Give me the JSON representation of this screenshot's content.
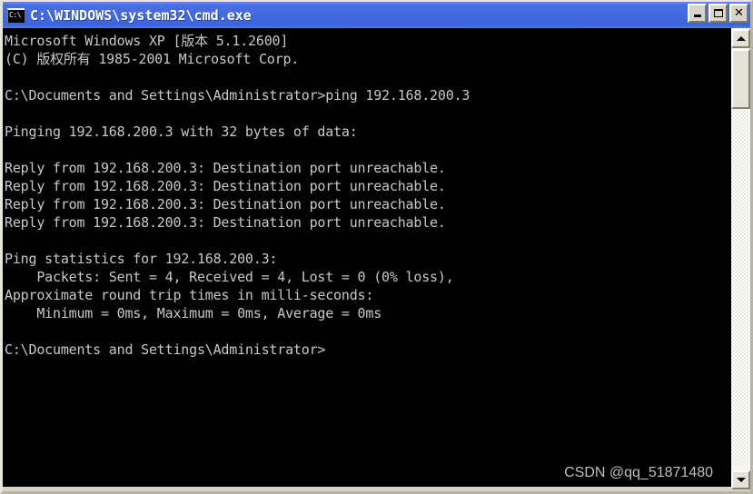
{
  "window": {
    "title": "C:\\WINDOWS\\system32\\cmd.exe",
    "icon_label": "C:\\",
    "icon_name": "cmd-console-icon",
    "titlebar_color": "#4169E1",
    "controls": {
      "minimize_label": "_",
      "maximize_label": "□",
      "close_label": "✕"
    }
  },
  "console": {
    "background_color": "#000000",
    "text_color": "#C8C8C8",
    "lines": [
      "Microsoft Windows XP [版本 5.1.2600]",
      "(C) 版权所有 1985-2001 Microsoft Corp.",
      "",
      "C:\\Documents and Settings\\Administrator>ping 192.168.200.3",
      "",
      "Pinging 192.168.200.3 with 32 bytes of data:",
      "",
      "Reply from 192.168.200.3: Destination port unreachable.",
      "Reply from 192.168.200.3: Destination port unreachable.",
      "Reply from 192.168.200.3: Destination port unreachable.",
      "Reply from 192.168.200.3: Destination port unreachable.",
      "",
      "Ping statistics for 192.168.200.3:",
      "    Packets: Sent = 4, Received = 4, Lost = 0 (0% loss),",
      "Approximate round trip times in milli-seconds:",
      "    Minimum = 0ms, Maximum = 0ms, Average = 0ms",
      "",
      "C:\\Documents and Settings\\Administrator>"
    ],
    "command": "ping 192.168.200.3",
    "target_host": "192.168.200.3",
    "payload_bytes": "32",
    "reply_message": "Destination port unreachable.",
    "statistics": {
      "sent": "4",
      "received": "4",
      "lost": "0",
      "loss_percent": "0%",
      "minimum_ms": "0ms",
      "maximum_ms": "0ms",
      "average_ms": "0ms"
    }
  },
  "watermark": {
    "text": "CSDN @qq_51871480",
    "color": "#BFBFBF"
  },
  "scrollbar": {
    "up_arrow": "▲",
    "down_arrow": "▼"
  }
}
